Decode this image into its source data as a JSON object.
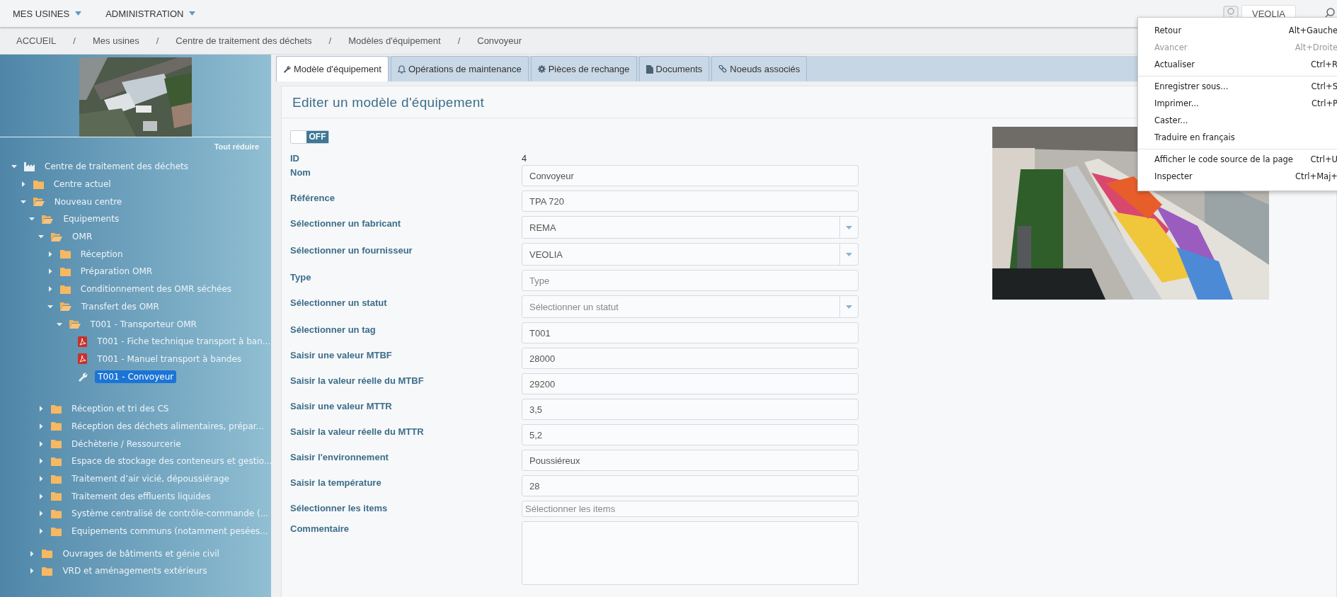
{
  "top_nav": {
    "menus": [
      {
        "label": "MES USINES"
      },
      {
        "label": "ADMINISTRATION"
      }
    ],
    "account": {
      "label": "VEOLIA"
    }
  },
  "breadcrumb": [
    {
      "label": "ACCUEIL"
    },
    {
      "separator": "/",
      "label": "Mes usines"
    },
    {
      "separator": "/",
      "label": "Centre de traitement des déchets"
    },
    {
      "separator": "/",
      "label": "Modèles d'équipement"
    },
    {
      "separator": "/",
      "label": "Convoyeur"
    }
  ],
  "sidebar": {
    "collapse_all": "Tout réduire",
    "tree": [
      {
        "label": "Centre de traitement des déchets",
        "kind": "factory",
        "expanded": true,
        "selected": false,
        "children": [
          {
            "label": "Centre actuel",
            "kind": "folder",
            "expanded": false,
            "selected": false
          },
          {
            "label": "Nouveau centre",
            "kind": "folder",
            "expanded": true,
            "selected": false,
            "children": [
              {
                "label": "Equipements",
                "kind": "folder",
                "expanded": true,
                "selected": false,
                "children": [
                  {
                    "label": "OMR",
                    "kind": "folder",
                    "expanded": true,
                    "selected": false,
                    "children": [
                      {
                        "label": "Réception",
                        "kind": "folder",
                        "expanded": false,
                        "selected": false
                      },
                      {
                        "label": "Préparation OMR",
                        "kind": "folder",
                        "expanded": false,
                        "selected": false
                      },
                      {
                        "label": "Conditionnement des OMR séchées",
                        "kind": "folder",
                        "expanded": false,
                        "selected": false
                      },
                      {
                        "label": "Transfert des OMR",
                        "kind": "folder",
                        "expanded": true,
                        "selected": false,
                        "children": [
                          {
                            "label": "T001 - Transporteur OMR",
                            "kind": "folder",
                            "expanded": true,
                            "selected": false,
                            "children": [
                              {
                                "label": "T001 - Fiche technique transport à ban...",
                                "kind": "pdf",
                                "selected": false
                              },
                              {
                                "label": "T001 - Manuel transport à bandes",
                                "kind": "pdf",
                                "selected": false
                              },
                              {
                                "label": "T001 - Convoyeur",
                                "kind": "tool",
                                "selected": true
                              }
                            ]
                          }
                        ]
                      }
                    ]
                  },
                  {
                    "label": "Réception et tri des CS",
                    "kind": "folder",
                    "expanded": false,
                    "selected": false
                  },
                  {
                    "label": "Réception des déchets alimentaires, prépar...",
                    "kind": "folder",
                    "expanded": false,
                    "selected": false
                  },
                  {
                    "label": "Déchèterie / Ressourcerie",
                    "kind": "folder",
                    "expanded": false,
                    "selected": false
                  },
                  {
                    "label": "Espace de stockage des conteneurs et gestio...",
                    "kind": "folder",
                    "expanded": false,
                    "selected": false
                  },
                  {
                    "label": "Traitement d’air vicié, dépoussiérage",
                    "kind": "folder",
                    "expanded": false,
                    "selected": false
                  },
                  {
                    "label": "Traitement des effluents liquides",
                    "kind": "folder",
                    "expanded": false,
                    "selected": false
                  },
                  {
                    "label": "Système centralisé de contrôle-commande (...",
                    "kind": "folder",
                    "expanded": false,
                    "selected": false
                  },
                  {
                    "label": "Equipements communs (notamment pesées...",
                    "kind": "folder",
                    "expanded": false,
                    "selected": false
                  }
                ]
              },
              {
                "label": "Ouvrages de bâtiments et génie civil",
                "kind": "folder",
                "expanded": false,
                "selected": false
              },
              {
                "label": "VRD et aménagements extérieurs",
                "kind": "folder",
                "expanded": false,
                "selected": false
              }
            ]
          }
        ]
      }
    ]
  },
  "tabs": [
    {
      "label": "Modèle d'équipement",
      "selected": true
    },
    {
      "label": "Opérations de maintenance",
      "selected": false
    },
    {
      "label": "Pièces de rechange",
      "selected": false
    },
    {
      "label": "Documents",
      "selected": false
    },
    {
      "label": "Noeuds associés",
      "selected": false
    }
  ],
  "form": {
    "title": "Editer un modèle d'équipement",
    "toggle": {
      "label": "OFF",
      "on": false
    },
    "fields": [
      {
        "label": "ID",
        "kind": "static",
        "value": "4"
      },
      {
        "label": "Nom",
        "kind": "text",
        "value": "Convoyeur"
      },
      {
        "label": "Référence",
        "kind": "text",
        "value": "TPA 720"
      },
      {
        "label": "Sélectionner un fabricant",
        "kind": "select",
        "value": "REMA"
      },
      {
        "label": "Sélectionner un fournisseur",
        "kind": "select",
        "value": "VEOLIA"
      },
      {
        "label": "Type",
        "kind": "text",
        "placeholder": "Type"
      },
      {
        "label": "Sélectionner un statut",
        "kind": "select",
        "placeholder": "Sélectionner un statut"
      },
      {
        "label": "Sélectionner un tag",
        "kind": "text",
        "value": "T001"
      },
      {
        "label": "Saisir une valeur MTBF",
        "kind": "text",
        "value": "28000"
      },
      {
        "label": "Saisir la valeur réelle du MTBF",
        "kind": "text",
        "value": "29200"
      },
      {
        "label": "Saisir une valeur MTTR",
        "kind": "text",
        "value": "3,5"
      },
      {
        "label": "Saisir la valeur réelle du MTTR",
        "kind": "text",
        "value": "5,2"
      },
      {
        "label": "Saisir l'environnement",
        "kind": "text",
        "value": "Poussiéreux"
      },
      {
        "label": "Saisir la température",
        "kind": "text",
        "value": "28"
      },
      {
        "label": "Sélectionner les items",
        "kind": "tags",
        "placeholder": "Sélectionner les items"
      },
      {
        "label": "Commentaire",
        "kind": "textarea"
      }
    ]
  },
  "context_menu": {
    "groups": [
      [
        {
          "label": "Retour",
          "shortcut": "Alt+Gauche",
          "disabled": false
        },
        {
          "label": "Avancer",
          "shortcut": "Alt+Droite",
          "disabled": true
        },
        {
          "label": "Actualiser",
          "shortcut": "Ctrl+R",
          "disabled": false
        }
      ],
      [
        {
          "label": "Enregistrer sous...",
          "shortcut": "Ctrl+S",
          "disabled": false
        },
        {
          "label": "Imprimer...",
          "shortcut": "Ctrl+P",
          "disabled": false
        },
        {
          "label": "Caster...",
          "disabled": false
        },
        {
          "label": "Traduire en français",
          "disabled": false
        }
      ],
      [
        {
          "label": "Afficher le code source de la page",
          "shortcut": "Ctrl+U",
          "disabled": false
        },
        {
          "label": "Inspecter",
          "shortcut": "Ctrl+Maj+",
          "disabled": false
        }
      ]
    ]
  }
}
